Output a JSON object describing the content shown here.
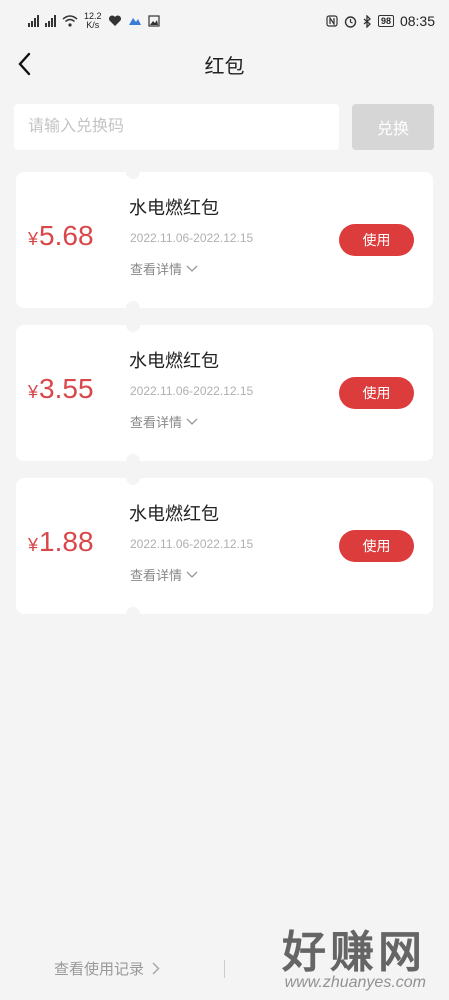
{
  "status_bar": {
    "net_speed_value": "12.2",
    "net_speed_unit": "K/s",
    "battery": "98",
    "time": "08:35"
  },
  "nav": {
    "title": "红包"
  },
  "redeem": {
    "placeholder": "请输入兑换码",
    "button_label": "兑换"
  },
  "coupons": [
    {
      "currency": "¥",
      "amount": "5.68",
      "name": "水电燃红包",
      "validity": "2022.11.06-2022.12.15",
      "detail_label": "查看详情",
      "use_label": "使用"
    },
    {
      "currency": "¥",
      "amount": "3.55",
      "name": "水电燃红包",
      "validity": "2022.11.06-2022.12.15",
      "detail_label": "查看详情",
      "use_label": "使用"
    },
    {
      "currency": "¥",
      "amount": "1.88",
      "name": "水电燃红包",
      "validity": "2022.11.06-2022.12.15",
      "detail_label": "查看详情",
      "use_label": "使用"
    }
  ],
  "footer": {
    "record_link": "查看使用记录"
  },
  "watermark": {
    "main": "好赚网",
    "url": "www.zhuanyes.com"
  },
  "colors": {
    "accent": "#dd3c3c",
    "amount": "#d9474a",
    "background": "#f4f4f4"
  }
}
